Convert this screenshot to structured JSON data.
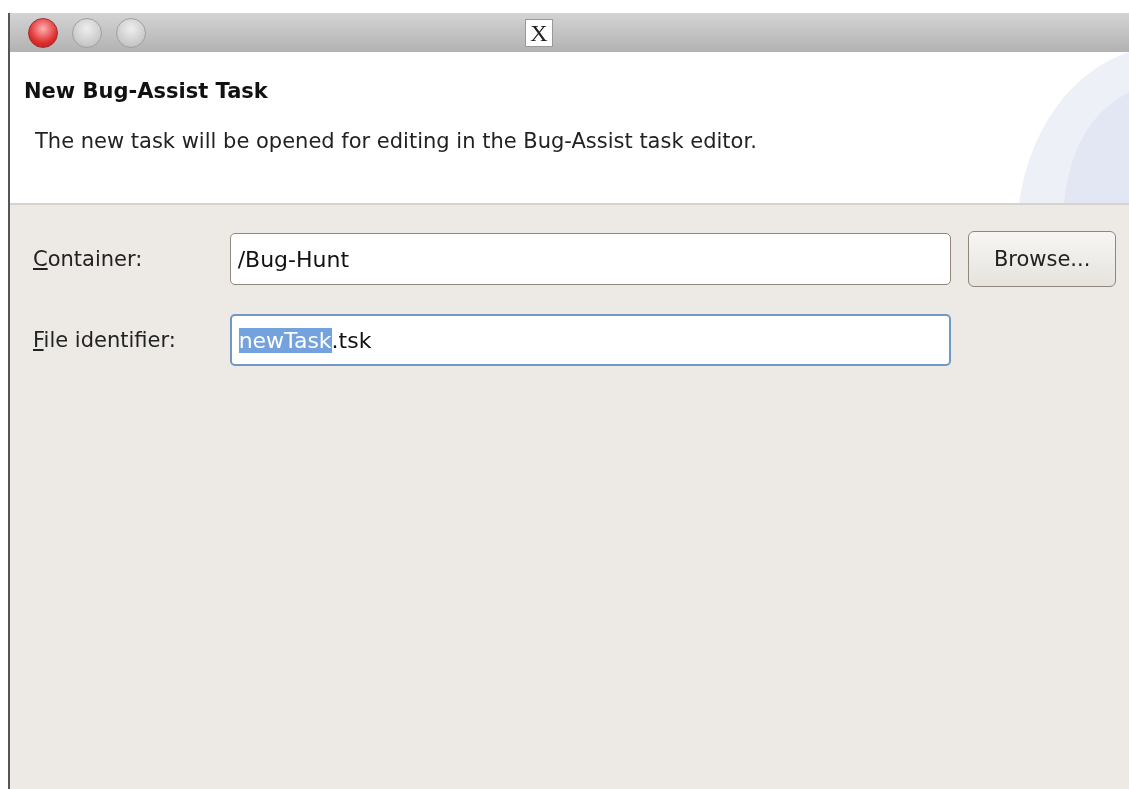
{
  "window": {
    "title_glyph": "X",
    "close_active": true
  },
  "header": {
    "title": "New Bug-Assist Task",
    "description": "The new task will be opened for editing in the Bug-Assist task editor."
  },
  "fields": [
    {
      "mnemonic": "C",
      "label_rest": "ontainer:",
      "value_rest": "/Bug-Hunt",
      "focused": false,
      "button": "Browse..."
    },
    {
      "mnemonic": "F",
      "label_rest": "ile identifier:",
      "value_selected": "newTask",
      "value_rest": ".tsk",
      "focused": true
    }
  ]
}
